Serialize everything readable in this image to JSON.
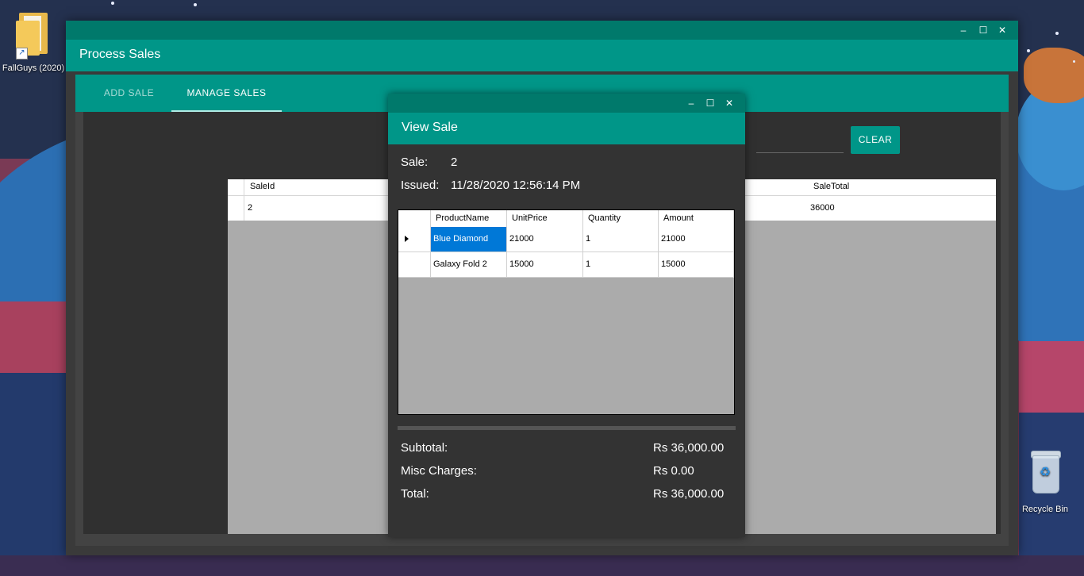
{
  "desktop": {
    "icons": [
      {
        "label": "FallGuys (2020)",
        "icon": "folder-shortcut-icon"
      },
      {
        "label": "Recycle Bin",
        "icon": "recycle-bin-icon"
      }
    ]
  },
  "main_window": {
    "title": "Process Sales",
    "controls": {
      "minimize": "–",
      "maximize": "☐",
      "close": "✕"
    },
    "tabs": [
      {
        "label": "ADD SALE",
        "active": false
      },
      {
        "label": "MANAGE SALES",
        "active": true
      }
    ],
    "clear_button": "CLEAR",
    "sales_grid": {
      "columns": [
        "SaleId",
        "SaleTotal"
      ],
      "rows": [
        {
          "SaleId": "2",
          "SaleTotal": "36000"
        }
      ]
    }
  },
  "view_sale_dialog": {
    "title": "View Sale",
    "controls": {
      "minimize": "–",
      "maximize": "☐",
      "close": "✕"
    },
    "sale_label": "Sale:",
    "sale_value": "2",
    "issued_label": "Issued:",
    "issued_value": "11/28/2020 12:56:14 PM",
    "items_grid": {
      "columns": [
        "ProductName",
        "UnitPrice",
        "Quantity",
        "Amount"
      ],
      "rows": [
        {
          "ProductName": "Blue Diamond",
          "UnitPrice": "21000",
          "Quantity": "1",
          "Amount": "21000",
          "selected": true
        },
        {
          "ProductName": "Galaxy Fold 2",
          "UnitPrice": "15000",
          "Quantity": "1",
          "Amount": "15000",
          "selected": false
        }
      ]
    },
    "totals": [
      {
        "label": "Subtotal:",
        "value": "Rs 36,000.00"
      },
      {
        "label": "Misc Charges:",
        "value": "Rs 0.00"
      },
      {
        "label": "Total:",
        "value": "Rs 36,000.00"
      }
    ]
  },
  "colors": {
    "primary": "#009688",
    "primary_dark": "#00796b",
    "selection": "#0078d7",
    "window_bg": "#303030"
  }
}
